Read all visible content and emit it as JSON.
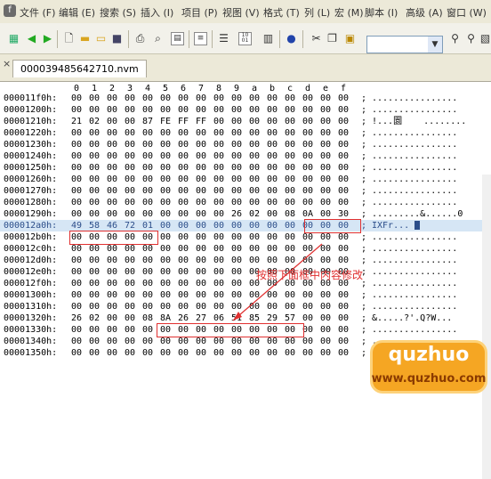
{
  "menu": {
    "logo_glyph": "f",
    "items": [
      {
        "label": "文件 (F)"
      },
      {
        "label": "编辑 (E)"
      },
      {
        "label": "搜索 (S)"
      },
      {
        "label": "插入 (I)"
      },
      {
        "label": "项目 (P)"
      },
      {
        "label": "视图 (V)"
      },
      {
        "label": "格式 (T)"
      },
      {
        "label": "列 (L)"
      },
      {
        "label": "宏 (M)"
      },
      {
        "label": "脚本 (I)"
      },
      {
        "label": "高级 (A)"
      },
      {
        "label": "窗口 (W)"
      }
    ]
  },
  "toolbar": {
    "binary_icon_label": "10\n01",
    "font_dropdown_value": ""
  },
  "tab": {
    "close_glyph": "×",
    "title": "000039485642710.nvm"
  },
  "ruler": [
    "0",
    "1",
    "2",
    "3",
    "4",
    "5",
    "6",
    "7",
    "8",
    "9",
    "a",
    "b",
    "c",
    "d",
    "e",
    "f"
  ],
  "rows": [
    {
      "addr": "000011f0h:",
      "bytes": [
        "00",
        "00",
        "00",
        "00",
        "00",
        "00",
        "00",
        "00",
        "00",
        "00",
        "00",
        "00",
        "00",
        "00",
        "00",
        "00"
      ],
      "ascii": "................"
    },
    {
      "addr": "00001200h:",
      "bytes": [
        "00",
        "00",
        "00",
        "00",
        "00",
        "00",
        "00",
        "00",
        "00",
        "00",
        "00",
        "00",
        "00",
        "00",
        "00",
        "00"
      ],
      "ascii": "................"
    },
    {
      "addr": "00001210h:",
      "bytes": [
        "21",
        "02",
        "00",
        "00",
        "87",
        "FE",
        "FF",
        "FF",
        "00",
        "00",
        "00",
        "00",
        "00",
        "00",
        "00",
        "00"
      ],
      "ascii": "!...圜    ........"
    },
    {
      "addr": "00001220h:",
      "bytes": [
        "00",
        "00",
        "00",
        "00",
        "00",
        "00",
        "00",
        "00",
        "00",
        "00",
        "00",
        "00",
        "00",
        "00",
        "00",
        "00"
      ],
      "ascii": "................"
    },
    {
      "addr": "00001230h:",
      "bytes": [
        "00",
        "00",
        "00",
        "00",
        "00",
        "00",
        "00",
        "00",
        "00",
        "00",
        "00",
        "00",
        "00",
        "00",
        "00",
        "00"
      ],
      "ascii": "................"
    },
    {
      "addr": "00001240h:",
      "bytes": [
        "00",
        "00",
        "00",
        "00",
        "00",
        "00",
        "00",
        "00",
        "00",
        "00",
        "00",
        "00",
        "00",
        "00",
        "00",
        "00"
      ],
      "ascii": "................"
    },
    {
      "addr": "00001250h:",
      "bytes": [
        "00",
        "00",
        "00",
        "00",
        "00",
        "00",
        "00",
        "00",
        "00",
        "00",
        "00",
        "00",
        "00",
        "00",
        "00",
        "00"
      ],
      "ascii": "................"
    },
    {
      "addr": "00001260h:",
      "bytes": [
        "00",
        "00",
        "00",
        "00",
        "00",
        "00",
        "00",
        "00",
        "00",
        "00",
        "00",
        "00",
        "00",
        "00",
        "00",
        "00"
      ],
      "ascii": "................"
    },
    {
      "addr": "00001270h:",
      "bytes": [
        "00",
        "00",
        "00",
        "00",
        "00",
        "00",
        "00",
        "00",
        "00",
        "00",
        "00",
        "00",
        "00",
        "00",
        "00",
        "00"
      ],
      "ascii": "................"
    },
    {
      "addr": "00001280h:",
      "bytes": [
        "00",
        "00",
        "00",
        "00",
        "00",
        "00",
        "00",
        "00",
        "00",
        "00",
        "00",
        "00",
        "00",
        "00",
        "00",
        "00"
      ],
      "ascii": "................"
    },
    {
      "addr": "00001290h:",
      "bytes": [
        "00",
        "00",
        "00",
        "00",
        "00",
        "00",
        "00",
        "00",
        "00",
        "26",
        "02",
        "00",
        "08",
        "0A",
        "00",
        "30"
      ],
      "ascii": ".........&......0"
    },
    {
      "addr": "000012a0h:",
      "bytes": [
        "49",
        "58",
        "46",
        "72",
        "01",
        "00",
        "00",
        "00",
        "00",
        "00",
        "00",
        "00",
        "00",
        "00",
        "00",
        "00"
      ],
      "ascii": "IXFr...",
      "active": true
    },
    {
      "addr": "000012b0h:",
      "bytes": [
        "00",
        "00",
        "00",
        "00",
        "00",
        "00",
        "00",
        "00",
        "00",
        "00",
        "00",
        "00",
        "00",
        "00",
        "00",
        "00"
      ],
      "ascii": "................"
    },
    {
      "addr": "000012c0h:",
      "bytes": [
        "00",
        "00",
        "00",
        "00",
        "00",
        "00",
        "00",
        "00",
        "00",
        "00",
        "00",
        "00",
        "00",
        "00",
        "00",
        "00"
      ],
      "ascii": "................"
    },
    {
      "addr": "000012d0h:",
      "bytes": [
        "00",
        "00",
        "00",
        "00",
        "00",
        "00",
        "00",
        "00",
        "00",
        "00",
        "00",
        "00",
        "00",
        "00",
        "00",
        "00"
      ],
      "ascii": "................"
    },
    {
      "addr": "000012e0h:",
      "bytes": [
        "00",
        "00",
        "00",
        "00",
        "00",
        "00",
        "00",
        "00",
        "00",
        "00",
        "00",
        "00",
        "00",
        "00",
        "00",
        "00"
      ],
      "ascii": "................"
    },
    {
      "addr": "000012f0h:",
      "bytes": [
        "00",
        "00",
        "00",
        "00",
        "00",
        "00",
        "00",
        "00",
        "00",
        "00",
        "00",
        "00",
        "00",
        "00",
        "00",
        "00"
      ],
      "ascii": "................"
    },
    {
      "addr": "00001300h:",
      "bytes": [
        "00",
        "00",
        "00",
        "00",
        "00",
        "00",
        "00",
        "00",
        "00",
        "00",
        "00",
        "00",
        "00",
        "00",
        "00",
        "00"
      ],
      "ascii": "................"
    },
    {
      "addr": "00001310h:",
      "bytes": [
        "00",
        "00",
        "00",
        "00",
        "00",
        "00",
        "00",
        "00",
        "00",
        "00",
        "00",
        "00",
        "00",
        "00",
        "00",
        "00"
      ],
      "ascii": "................"
    },
    {
      "addr": "00001320h:",
      "bytes": [
        "26",
        "02",
        "00",
        "00",
        "08",
        "8A",
        "26",
        "27",
        "06",
        "51",
        "85",
        "29",
        "57",
        "00",
        "00",
        "00"
      ],
      "ascii": "&.....?'.Q?W..."
    },
    {
      "addr": "00001330h:",
      "bytes": [
        "00",
        "00",
        "00",
        "00",
        "00",
        "00",
        "00",
        "00",
        "00",
        "00",
        "00",
        "00",
        "00",
        "00",
        "00",
        "00"
      ],
      "ascii": "................"
    },
    {
      "addr": "00001340h:",
      "bytes": [
        "00",
        "00",
        "00",
        "00",
        "00",
        "00",
        "00",
        "00",
        "00",
        "00",
        "00",
        "00",
        "00",
        "00",
        "00",
        "00"
      ],
      "ascii": "................"
    },
    {
      "addr": "00001350h:",
      "bytes": [
        "00",
        "00",
        "00",
        "00",
        "00",
        "00",
        "00",
        "00",
        "00",
        "00",
        "00",
        "00",
        "00",
        "00",
        "00",
        "00"
      ],
      "ascii": "................"
    }
  ],
  "annotation": "按照下面框中内容修改",
  "watermark": {
    "brand": "quzhuo",
    "url": "www.quzhuo.com"
  },
  "colors": {
    "highlight_red": "#e03030",
    "active_row": "#d6e6f5",
    "watermark_orange": "#f5a623"
  }
}
